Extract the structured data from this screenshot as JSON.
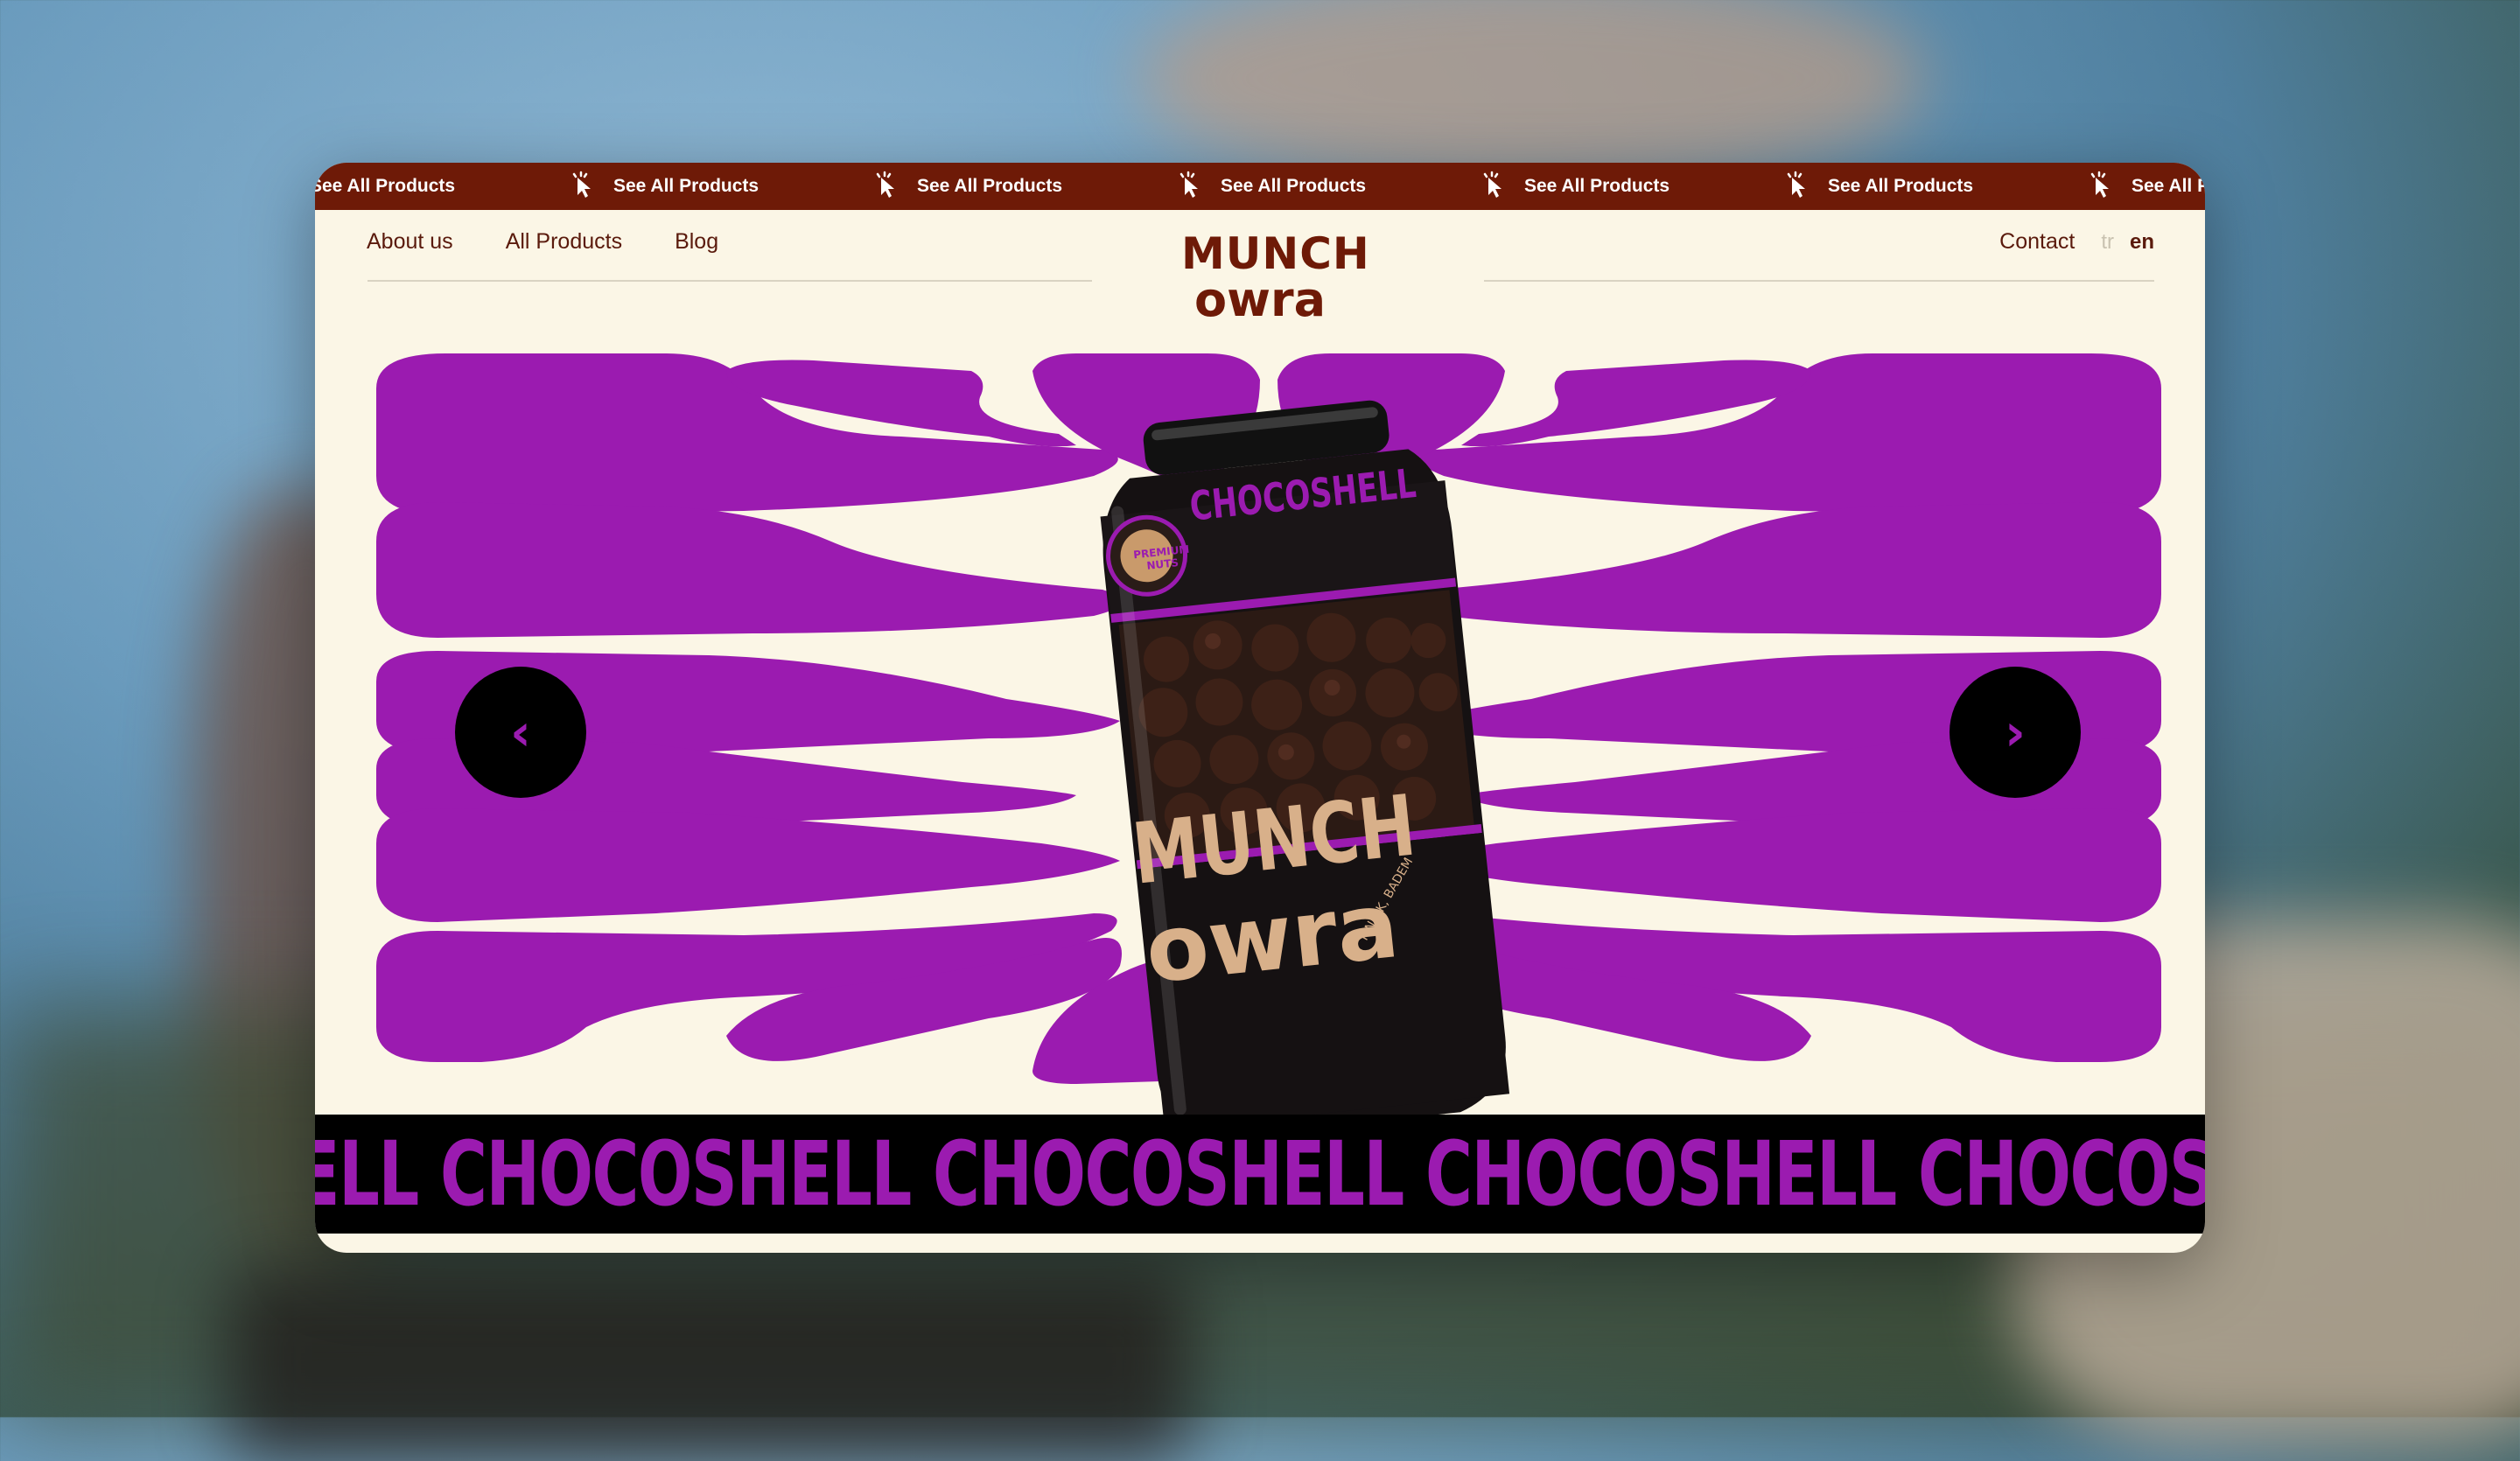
{
  "ticker": {
    "items": [
      "See All Products",
      "See All Products",
      "See All Products",
      "See All Products",
      "See All Products",
      "See All Products",
      "See All Products"
    ],
    "icon": "pointer-click-icon",
    "color": "#6e1a07"
  },
  "nav": {
    "links": [
      {
        "label": "About us"
      },
      {
        "label": "All Products"
      },
      {
        "label": "Blog"
      }
    ],
    "contact": "Contact",
    "languages": {
      "inactive": "tr",
      "active": "en"
    }
  },
  "logo": {
    "top": "MUNCH",
    "bottom": "owra"
  },
  "hero": {
    "accent": "#9b1bb0",
    "prev_icon": "chevron-left-icon",
    "next_icon": "chevron-right-icon",
    "product": {
      "label": "CHOCOSHELL",
      "badge": "PREMIUM NUTS",
      "brand_top": "MUNCH",
      "brand_bottom": "owra",
      "side_text": "FINDIK, BADEM"
    }
  },
  "marquee": {
    "items": [
      "CHOCOSHELL",
      "CHOCOSHELL",
      "CHOCOSHELL",
      "CHOCOSHELL",
      "CHOCOSHELL"
    ],
    "color": "#9b1bb0"
  }
}
